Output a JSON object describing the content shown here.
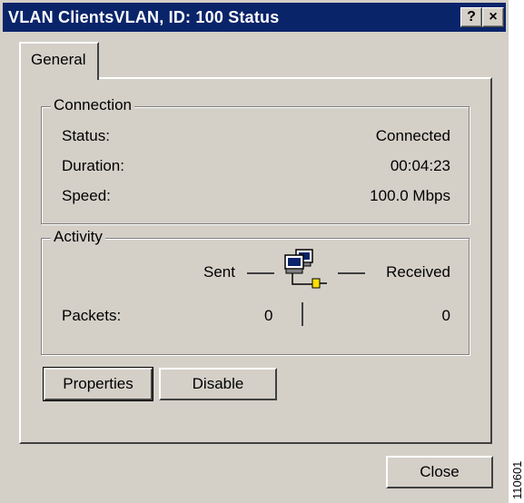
{
  "window": {
    "title": "VLAN ClientsVLAN, ID: 100 Status",
    "help_button": "?",
    "close_button": "×"
  },
  "tabs": [
    {
      "label": "General",
      "selected": true
    }
  ],
  "connection": {
    "legend": "Connection",
    "rows": [
      {
        "label": "Status:",
        "value": "Connected"
      },
      {
        "label": "Duration:",
        "value": "00:04:23"
      },
      {
        "label": "Speed:",
        "value": "100.0 Mbps"
      }
    ]
  },
  "activity": {
    "legend": "Activity",
    "sent_label": "Sent",
    "received_label": "Received",
    "packets_label": "Packets:",
    "packets_sent": "0",
    "packets_received": "0",
    "icon": "network-computers-icon"
  },
  "buttons": {
    "properties": "Properties",
    "disable": "Disable",
    "close": "Close"
  },
  "figure_id": "110601",
  "colors": {
    "titlebar": "#0a246a",
    "face": "#d4d0c8"
  }
}
